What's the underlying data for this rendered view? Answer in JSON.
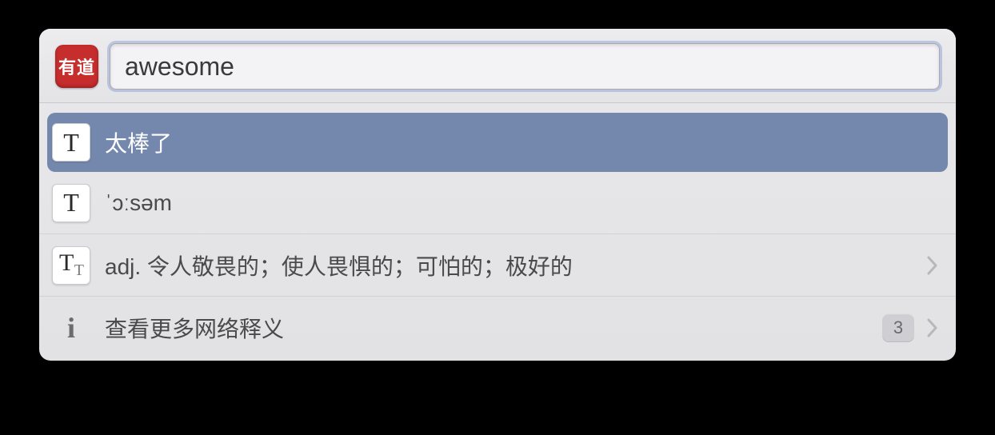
{
  "app": {
    "logo_text": "有道"
  },
  "search": {
    "value": "awesome",
    "placeholder": ""
  },
  "results": [
    {
      "icon": "text",
      "text": "太棒了",
      "selected": true,
      "has_chevron": false,
      "badge": null
    },
    {
      "icon": "text",
      "text": "ˈɔːsəm",
      "selected": false,
      "has_chevron": false,
      "badge": null
    },
    {
      "icon": "text-sizes",
      "text": "adj. 令人敬畏的；使人畏惧的；可怕的；极好的",
      "selected": false,
      "has_chevron": true,
      "badge": null
    },
    {
      "icon": "info",
      "text": "查看更多网络释义",
      "selected": false,
      "has_chevron": true,
      "badge": "3"
    }
  ]
}
